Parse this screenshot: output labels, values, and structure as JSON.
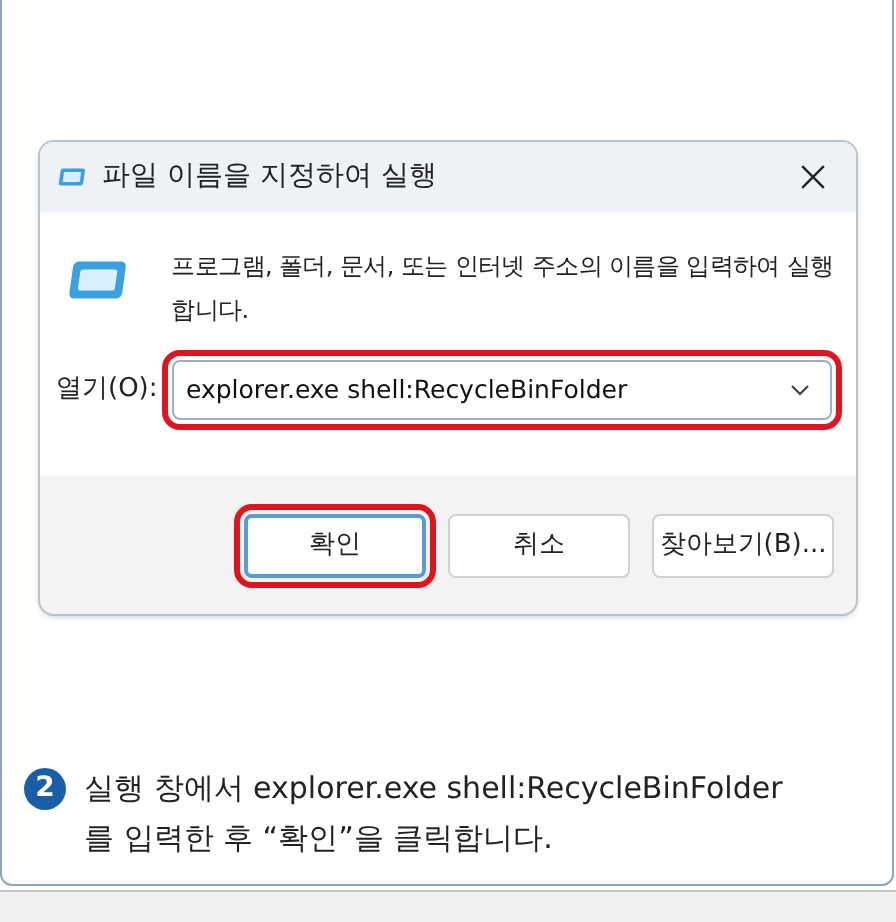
{
  "dialog": {
    "title": "파일 이름을 지정하여 실행",
    "description": "프로그램, 폴더, 문서, 또는 인터넷 주소의 이름을 입력하여 실행합니다.",
    "open_label": "열기(O):",
    "open_field": {
      "value": "explorer.exe shell:RecycleBinFolder",
      "highlighted": true
    },
    "buttons": [
      {
        "label": "확인",
        "default": true,
        "highlighted": true
      },
      {
        "label": "취소",
        "default": false,
        "highlighted": false
      },
      {
        "label": "찾아보기(B)...",
        "default": false,
        "highlighted": false
      }
    ]
  },
  "caption": {
    "step": "2",
    "lines": [
      "실행 창에서 explorer.exe shell:RecycleBinFolder",
      "를 입력한 후 “확인”을 클릭합니다."
    ]
  }
}
